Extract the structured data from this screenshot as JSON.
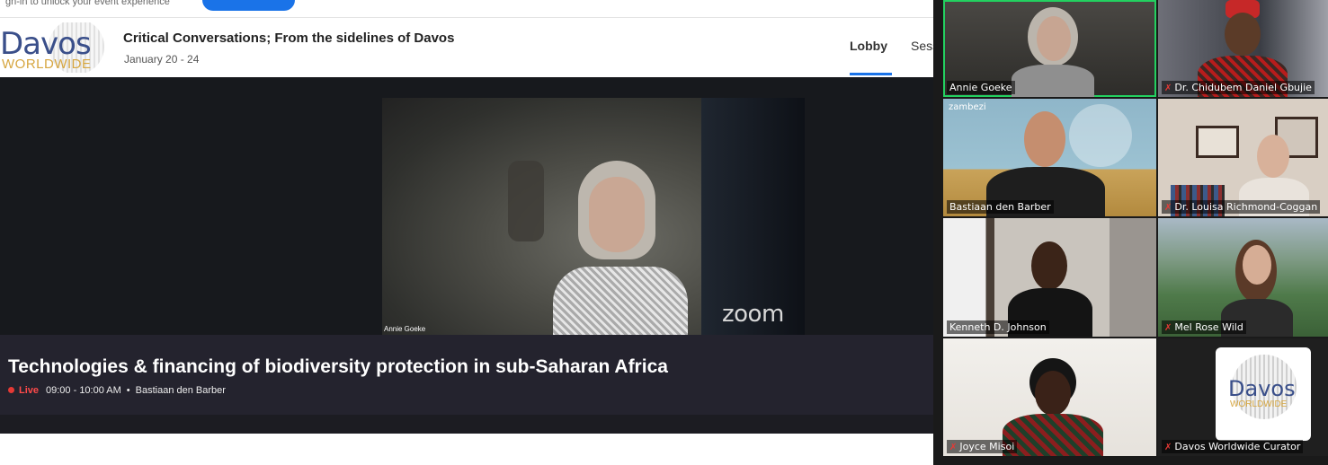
{
  "top_strip": {
    "cut_text": "gn-in to unlock your event experience"
  },
  "header": {
    "logo": {
      "word1": "Davos",
      "word2": "WORLDWIDE"
    },
    "event_title": "Critical Conversations; From the sidelines of Davos",
    "event_dates": "January 20 - 24",
    "tabs": [
      {
        "label": "Lobby",
        "active": true
      },
      {
        "label": "Sess",
        "active": false
      }
    ]
  },
  "stage": {
    "video_speaker_label": "Annie Goeke",
    "video_watermark": "zoom",
    "session_title": "Technologies & financing of biodiversity protection in sub-Saharan Africa",
    "status": "Live",
    "time": "09:00 - 10:00 AM",
    "separator": "•",
    "host": "Bastiaan den Barber"
  },
  "gallery": {
    "participants": [
      {
        "name": "Annie Goeke",
        "muted": false,
        "speaking": true
      },
      {
        "name": "Dr. Chidubem Daniel Gbujie",
        "muted": true,
        "speaking": false
      },
      {
        "name": "Bastiaan den Barber",
        "muted": false,
        "speaking": false,
        "background_label": "zambezi"
      },
      {
        "name": "Dr. Louisa Richmond-Coggan",
        "muted": true,
        "speaking": false
      },
      {
        "name": "Kenneth D. Johnson",
        "muted": false,
        "speaking": false
      },
      {
        "name": "Mel Rose Wild",
        "muted": true,
        "speaking": false
      },
      {
        "name": "Joyce Misoi",
        "muted": true,
        "speaking": false
      },
      {
        "name": "Davos Worldwide Curator",
        "muted": true,
        "speaking": false
      }
    ],
    "curator_logo": {
      "word1": "Davos",
      "word2": "WORLDWIDE"
    }
  },
  "colors": {
    "accent": "#1a73e8",
    "live": "#e53935",
    "speaking_border": "#23d160",
    "stage_bg": "#17191d",
    "infobar_bg": "#24232e"
  }
}
